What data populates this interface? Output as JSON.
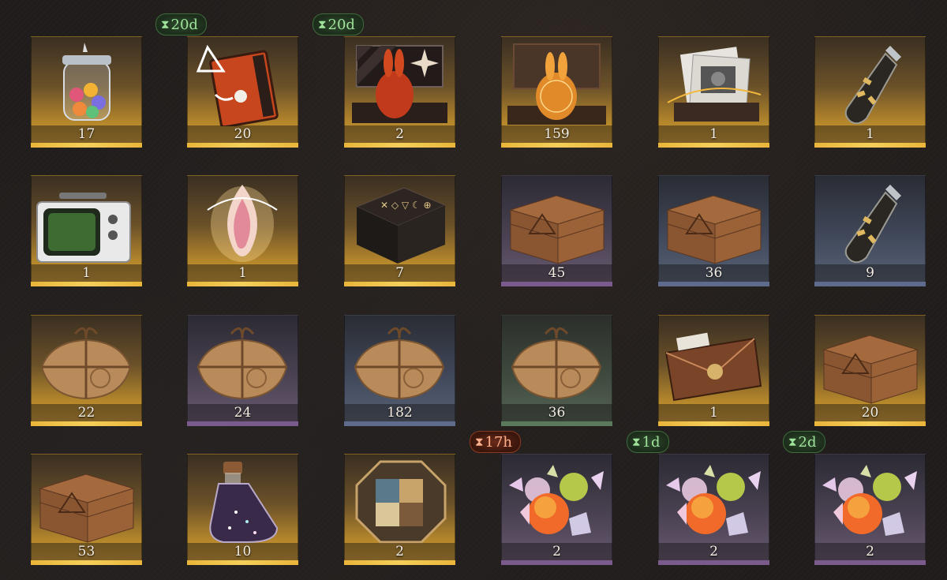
{
  "items": [
    {
      "name": "candy-jar",
      "count": "17",
      "rarity": "gold",
      "timer": null,
      "timer_style": null
    },
    {
      "name": "orange-cassette-device",
      "count": "20",
      "rarity": "gold",
      "timer": "20d",
      "timer_style": "green"
    },
    {
      "name": "red-rabbit-statue-case",
      "count": "2",
      "rarity": "gold",
      "timer": "20d",
      "timer_style": "green"
    },
    {
      "name": "golden-rabbit-statue-case",
      "count": "159",
      "rarity": "gold",
      "timer": null,
      "timer_style": null
    },
    {
      "name": "photo-album",
      "count": "1",
      "rarity": "gold",
      "timer": null,
      "timer_style": null
    },
    {
      "name": "message-bottle",
      "count": "1",
      "rarity": "gold",
      "timer": null,
      "timer_style": null
    },
    {
      "name": "retro-television",
      "count": "1",
      "rarity": "gold",
      "timer": null,
      "timer_style": null
    },
    {
      "name": "glowing-flame-essence",
      "count": "1",
      "rarity": "gold",
      "timer": null,
      "timer_style": null
    },
    {
      "name": "rune-table",
      "count": "7",
      "rarity": "gold",
      "timer": null,
      "timer_style": null
    },
    {
      "name": "wooden-crate",
      "count": "45",
      "rarity": "purple",
      "timer": null,
      "timer_style": null
    },
    {
      "name": "wooden-crate",
      "count": "36",
      "rarity": "blue",
      "timer": null,
      "timer_style": null
    },
    {
      "name": "message-bottle",
      "count": "9",
      "rarity": "blue",
      "timer": null,
      "timer_style": null
    },
    {
      "name": "wrapped-parcel",
      "count": "22",
      "rarity": "gold",
      "timer": null,
      "timer_style": null
    },
    {
      "name": "wrapped-parcel",
      "count": "24",
      "rarity": "purple",
      "timer": null,
      "timer_style": null
    },
    {
      "name": "wrapped-parcel",
      "count": "182",
      "rarity": "blue",
      "timer": null,
      "timer_style": null
    },
    {
      "name": "wrapped-parcel",
      "count": "36",
      "rarity": "green",
      "timer": null,
      "timer_style": null
    },
    {
      "name": "sealed-envelope",
      "count": "1",
      "rarity": "gold",
      "timer": null,
      "timer_style": null
    },
    {
      "name": "wooden-crate",
      "count": "20",
      "rarity": "gold",
      "timer": null,
      "timer_style": null
    },
    {
      "name": "wooden-crate",
      "count": "53",
      "rarity": "gold",
      "timer": null,
      "timer_style": null
    },
    {
      "name": "starry-potion-bottle",
      "count": "10",
      "rarity": "gold",
      "timer": null,
      "timer_style": null
    },
    {
      "name": "puzzle-box",
      "count": "2",
      "rarity": "gold",
      "timer": null,
      "timer_style": null
    },
    {
      "name": "wrapped-candies",
      "count": "2",
      "rarity": "purple",
      "timer": "17h",
      "timer_style": "red"
    },
    {
      "name": "wrapped-candies",
      "count": "2",
      "rarity": "purple",
      "timer": "1d",
      "timer_style": "green"
    },
    {
      "name": "wrapped-candies",
      "count": "2",
      "rarity": "purple",
      "timer": "2d",
      "timer_style": "green"
    }
  ],
  "hourglass_glyph": "⧗"
}
